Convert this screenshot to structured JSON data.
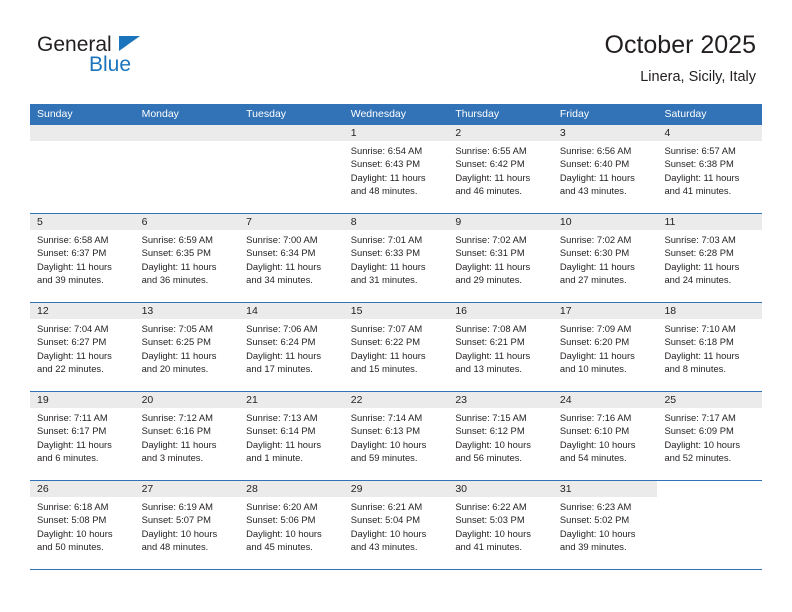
{
  "brand": {
    "name_top": "General",
    "name_bottom": "Blue",
    "accent_color": "#1c75bc"
  },
  "header": {
    "title": "October 2025",
    "subtitle": "Linera, Sicily, Italy"
  },
  "theme": {
    "header_blue": "#3272b6",
    "day_band_gray": "#ebebeb",
    "text_color": "#231f20"
  },
  "weekdays": [
    "Sunday",
    "Monday",
    "Tuesday",
    "Wednesday",
    "Thursday",
    "Friday",
    "Saturday"
  ],
  "labels": {
    "sunrise_prefix": "Sunrise:",
    "sunset_prefix": "Sunset:",
    "daylight_prefix": "Daylight:"
  },
  "weeks": [
    [
      {
        "day": "",
        "empty": true
      },
      {
        "day": "",
        "empty": true
      },
      {
        "day": "",
        "empty": true
      },
      {
        "day": "1",
        "sunrise": "Sunrise: 6:54 AM",
        "sunset": "Sunset: 6:43 PM",
        "daylight_line1": "Daylight: 11 hours",
        "daylight_line2": "and 48 minutes."
      },
      {
        "day": "2",
        "sunrise": "Sunrise: 6:55 AM",
        "sunset": "Sunset: 6:42 PM",
        "daylight_line1": "Daylight: 11 hours",
        "daylight_line2": "and 46 minutes."
      },
      {
        "day": "3",
        "sunrise": "Sunrise: 6:56 AM",
        "sunset": "Sunset: 6:40 PM",
        "daylight_line1": "Daylight: 11 hours",
        "daylight_line2": "and 43 minutes."
      },
      {
        "day": "4",
        "sunrise": "Sunrise: 6:57 AM",
        "sunset": "Sunset: 6:38 PM",
        "daylight_line1": "Daylight: 11 hours",
        "daylight_line2": "and 41 minutes."
      }
    ],
    [
      {
        "day": "5",
        "sunrise": "Sunrise: 6:58 AM",
        "sunset": "Sunset: 6:37 PM",
        "daylight_line1": "Daylight: 11 hours",
        "daylight_line2": "and 39 minutes."
      },
      {
        "day": "6",
        "sunrise": "Sunrise: 6:59 AM",
        "sunset": "Sunset: 6:35 PM",
        "daylight_line1": "Daylight: 11 hours",
        "daylight_line2": "and 36 minutes."
      },
      {
        "day": "7",
        "sunrise": "Sunrise: 7:00 AM",
        "sunset": "Sunset: 6:34 PM",
        "daylight_line1": "Daylight: 11 hours",
        "daylight_line2": "and 34 minutes."
      },
      {
        "day": "8",
        "sunrise": "Sunrise: 7:01 AM",
        "sunset": "Sunset: 6:33 PM",
        "daylight_line1": "Daylight: 11 hours",
        "daylight_line2": "and 31 minutes."
      },
      {
        "day": "9",
        "sunrise": "Sunrise: 7:02 AM",
        "sunset": "Sunset: 6:31 PM",
        "daylight_line1": "Daylight: 11 hours",
        "daylight_line2": "and 29 minutes."
      },
      {
        "day": "10",
        "sunrise": "Sunrise: 7:02 AM",
        "sunset": "Sunset: 6:30 PM",
        "daylight_line1": "Daylight: 11 hours",
        "daylight_line2": "and 27 minutes."
      },
      {
        "day": "11",
        "sunrise": "Sunrise: 7:03 AM",
        "sunset": "Sunset: 6:28 PM",
        "daylight_line1": "Daylight: 11 hours",
        "daylight_line2": "and 24 minutes."
      }
    ],
    [
      {
        "day": "12",
        "sunrise": "Sunrise: 7:04 AM",
        "sunset": "Sunset: 6:27 PM",
        "daylight_line1": "Daylight: 11 hours",
        "daylight_line2": "and 22 minutes."
      },
      {
        "day": "13",
        "sunrise": "Sunrise: 7:05 AM",
        "sunset": "Sunset: 6:25 PM",
        "daylight_line1": "Daylight: 11 hours",
        "daylight_line2": "and 20 minutes."
      },
      {
        "day": "14",
        "sunrise": "Sunrise: 7:06 AM",
        "sunset": "Sunset: 6:24 PM",
        "daylight_line1": "Daylight: 11 hours",
        "daylight_line2": "and 17 minutes."
      },
      {
        "day": "15",
        "sunrise": "Sunrise: 7:07 AM",
        "sunset": "Sunset: 6:22 PM",
        "daylight_line1": "Daylight: 11 hours",
        "daylight_line2": "and 15 minutes."
      },
      {
        "day": "16",
        "sunrise": "Sunrise: 7:08 AM",
        "sunset": "Sunset: 6:21 PM",
        "daylight_line1": "Daylight: 11 hours",
        "daylight_line2": "and 13 minutes."
      },
      {
        "day": "17",
        "sunrise": "Sunrise: 7:09 AM",
        "sunset": "Sunset: 6:20 PM",
        "daylight_line1": "Daylight: 11 hours",
        "daylight_line2": "and 10 minutes."
      },
      {
        "day": "18",
        "sunrise": "Sunrise: 7:10 AM",
        "sunset": "Sunset: 6:18 PM",
        "daylight_line1": "Daylight: 11 hours",
        "daylight_line2": "and 8 minutes."
      }
    ],
    [
      {
        "day": "19",
        "sunrise": "Sunrise: 7:11 AM",
        "sunset": "Sunset: 6:17 PM",
        "daylight_line1": "Daylight: 11 hours",
        "daylight_line2": "and 6 minutes."
      },
      {
        "day": "20",
        "sunrise": "Sunrise: 7:12 AM",
        "sunset": "Sunset: 6:16 PM",
        "daylight_line1": "Daylight: 11 hours",
        "daylight_line2": "and 3 minutes."
      },
      {
        "day": "21",
        "sunrise": "Sunrise: 7:13 AM",
        "sunset": "Sunset: 6:14 PM",
        "daylight_line1": "Daylight: 11 hours",
        "daylight_line2": "and 1 minute."
      },
      {
        "day": "22",
        "sunrise": "Sunrise: 7:14 AM",
        "sunset": "Sunset: 6:13 PM",
        "daylight_line1": "Daylight: 10 hours",
        "daylight_line2": "and 59 minutes."
      },
      {
        "day": "23",
        "sunrise": "Sunrise: 7:15 AM",
        "sunset": "Sunset: 6:12 PM",
        "daylight_line1": "Daylight: 10 hours",
        "daylight_line2": "and 56 minutes."
      },
      {
        "day": "24",
        "sunrise": "Sunrise: 7:16 AM",
        "sunset": "Sunset: 6:10 PM",
        "daylight_line1": "Daylight: 10 hours",
        "daylight_line2": "and 54 minutes."
      },
      {
        "day": "25",
        "sunrise": "Sunrise: 7:17 AM",
        "sunset": "Sunset: 6:09 PM",
        "daylight_line1": "Daylight: 10 hours",
        "daylight_line2": "and 52 minutes."
      }
    ],
    [
      {
        "day": "26",
        "sunrise": "Sunrise: 6:18 AM",
        "sunset": "Sunset: 5:08 PM",
        "daylight_line1": "Daylight: 10 hours",
        "daylight_line2": "and 50 minutes."
      },
      {
        "day": "27",
        "sunrise": "Sunrise: 6:19 AM",
        "sunset": "Sunset: 5:07 PM",
        "daylight_line1": "Daylight: 10 hours",
        "daylight_line2": "and 48 minutes."
      },
      {
        "day": "28",
        "sunrise": "Sunrise: 6:20 AM",
        "sunset": "Sunset: 5:06 PM",
        "daylight_line1": "Daylight: 10 hours",
        "daylight_line2": "and 45 minutes."
      },
      {
        "day": "29",
        "sunrise": "Sunrise: 6:21 AM",
        "sunset": "Sunset: 5:04 PM",
        "daylight_line1": "Daylight: 10 hours",
        "daylight_line2": "and 43 minutes."
      },
      {
        "day": "30",
        "sunrise": "Sunrise: 6:22 AM",
        "sunset": "Sunset: 5:03 PM",
        "daylight_line1": "Daylight: 10 hours",
        "daylight_line2": "and 41 minutes."
      },
      {
        "day": "31",
        "sunrise": "Sunrise: 6:23 AM",
        "sunset": "Sunset: 5:02 PM",
        "daylight_line1": "Daylight: 10 hours",
        "daylight_line2": "and 39 minutes."
      },
      {
        "day": "",
        "empty": true,
        "blank": true
      }
    ]
  ]
}
